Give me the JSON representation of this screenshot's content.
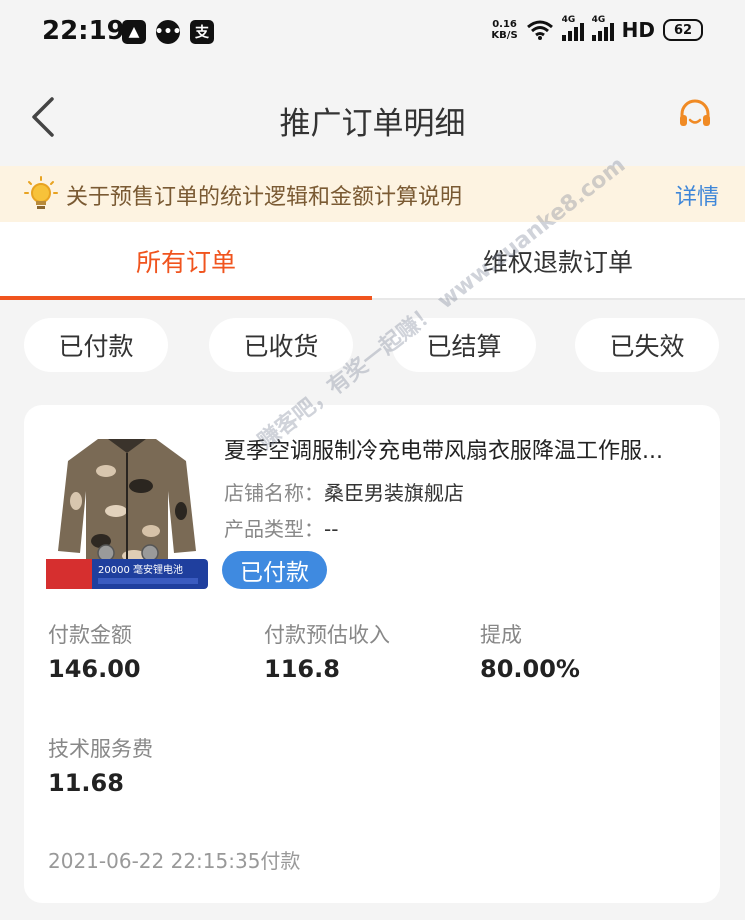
{
  "status_bar": {
    "time": "22:19",
    "net_speed_value": "0.16",
    "net_speed_unit": "KB/S",
    "sim1": "4G",
    "sim2": "4G",
    "hd": "HD",
    "battery": "62"
  },
  "nav": {
    "title": "推广订单明细"
  },
  "notice": {
    "text": "关于预售订单的统计逻辑和金额计算说明",
    "link": "详情"
  },
  "tabs": [
    {
      "label": "所有订单",
      "active": true
    },
    {
      "label": "维权退款订单",
      "active": false
    }
  ],
  "filters": [
    "已付款",
    "已收货",
    "已结算",
    "已失效"
  ],
  "order": {
    "title": "夏季空调服制冷充电带风扇衣服降温工作服...",
    "shop_label": "店铺名称：",
    "shop_name": "桑臣男装旗舰店",
    "type_label": "产品类型：",
    "type_value": "--",
    "status": "已付款",
    "thumb_caption": "20000 毫安锂电池",
    "stats": [
      {
        "label": "付款金额",
        "value": "146.00"
      },
      {
        "label": "付款预估收入",
        "value": "116.8"
      },
      {
        "label": "提成",
        "value": "80.00%"
      },
      {
        "label": "技术服务费",
        "value": "11.68"
      }
    ],
    "time": "2021-06-22 22:15:35付款"
  },
  "watermark": "赚客吧，有奖一起赚！ www.zuanke8.com",
  "colors": {
    "accent": "#f0541e",
    "pill": "#3f8ae0",
    "notice_bg": "#fdf3e1",
    "link": "#3e86d8"
  }
}
